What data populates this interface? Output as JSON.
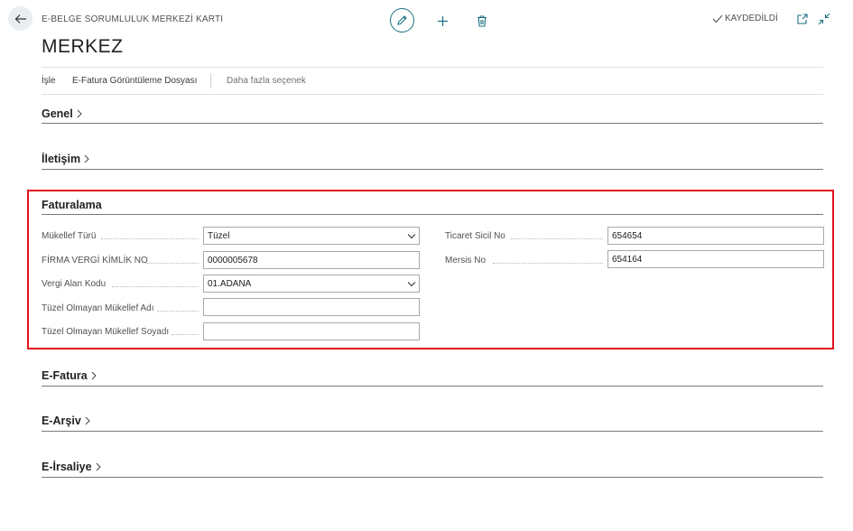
{
  "header": {
    "breadcrumb": "E-BELGE SORUMLULUK MERKEZİ KARTI",
    "title": "MERKEZ",
    "status": "KAYDEDİLDİ"
  },
  "actions": {
    "process": "İşle",
    "einvoice_view_file": "E-Fatura Görüntüleme Dosyası",
    "more_options": "Daha fazla seçenek"
  },
  "sections": {
    "general": "Genel",
    "contact": "İletişim",
    "invoicing": "Faturalama",
    "einvoice": "E-Fatura",
    "earchive": "E-Arşiv",
    "edispatch": "E-İrsaliye"
  },
  "invoicing": {
    "taxpayer_type_label": "Mükellef Türü",
    "taxpayer_type_value": "Tüzel",
    "tax_id_label": "FİRMA VERGİ KİMLİK NO",
    "tax_id_value": "0000005678",
    "tax_area_label": "Vergi Alan Kodu",
    "tax_area_value": "01.ADANA",
    "non_corp_name_label": "Tüzel Olmayan Mükellef Adı",
    "non_corp_name_value": "",
    "non_corp_surname_label": "Tüzel Olmayan Mükellef Soyadı",
    "non_corp_surname_value": "",
    "trade_registry_label": "Ticaret Sicil No",
    "trade_registry_value": "654654",
    "mersis_label": "Mersis No",
    "mersis_value": "654164"
  },
  "icons": {
    "back": "back-arrow-icon",
    "edit": "pencil-icon",
    "add": "plus-icon",
    "delete": "trash-icon",
    "saved": "checkmark-icon",
    "popout": "popout-icon",
    "collapse": "collapse-icon",
    "section_expand": "chevron-right-icon",
    "dropdown": "chevron-down-icon"
  },
  "colors": {
    "accent": "#1a6f80",
    "highlight": "#e0141e"
  }
}
